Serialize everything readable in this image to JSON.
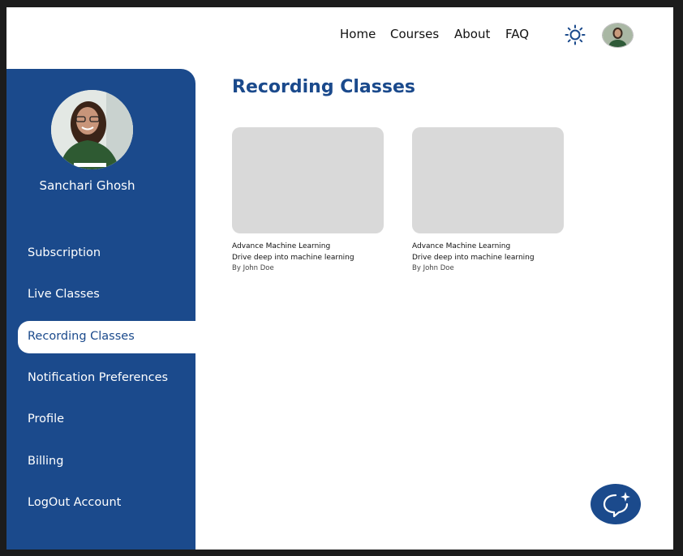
{
  "nav": {
    "links": [
      "Home",
      "Courses",
      "About",
      "FAQ"
    ]
  },
  "icons": {
    "theme_toggle": "sun-icon",
    "chat": "chat-sparkle-icon",
    "avatar": "user-avatar"
  },
  "colors": {
    "primary": "#1b4a8c",
    "thumb_placeholder": "#d9d9d9"
  },
  "sidebar": {
    "user_name": "Sanchari Ghosh",
    "items": [
      {
        "label": "Subscription"
      },
      {
        "label": "Live Classes"
      },
      {
        "label": "Recording Classes",
        "active": true
      },
      {
        "label": "Notification Preferences"
      },
      {
        "label": "Profile"
      },
      {
        "label": "Billing"
      },
      {
        "label": "LogOut Account"
      }
    ]
  },
  "main": {
    "title": "Recording Classes",
    "courses": [
      {
        "title": "Advance Machine Learning",
        "subtitle": "Drive deep into machine learning",
        "author": "By John Doe"
      },
      {
        "title": "Advance Machine Learning",
        "subtitle": "Drive deep into machine learning",
        "author": "By John Doe"
      }
    ]
  }
}
